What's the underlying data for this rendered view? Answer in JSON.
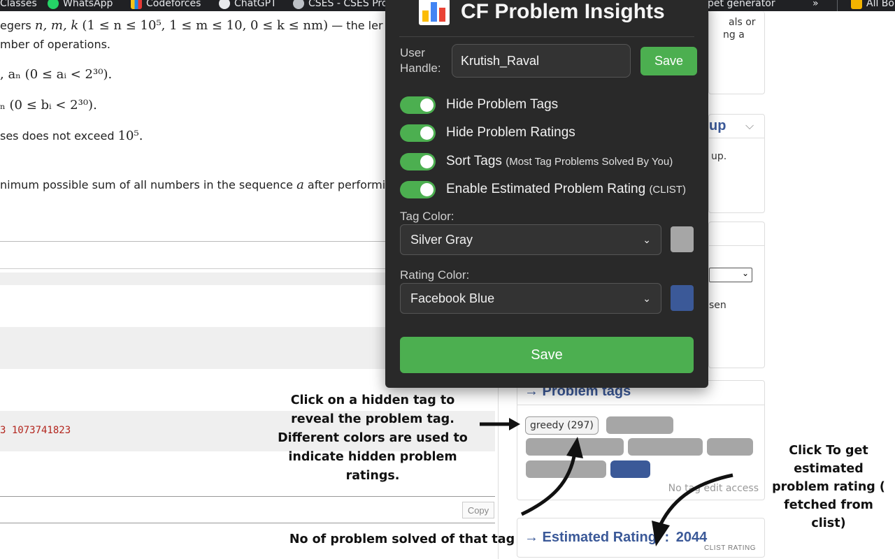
{
  "bookmarks": [
    {
      "label": "Classes",
      "icon": "folder-icon"
    },
    {
      "label": "WhatsApp",
      "icon": "whatsapp-icon"
    },
    {
      "label": "Codeforces",
      "icon": "codeforces-icon"
    },
    {
      "label": "ChatGPT",
      "icon": "chatgpt-icon"
    },
    {
      "label": "CSES - CSES Pro",
      "icon": "globe-icon"
    },
    {
      "label": "pet generator",
      "icon": "bookmark-icon"
    },
    {
      "label": "»",
      "icon": "more-icon"
    },
    {
      "label": "All Bo",
      "icon": "folder-icon"
    }
  ],
  "statement": {
    "line1_prefix": "egers",
    "line1_vars": "n, m, k",
    "line1_constraint": "(1 ≤ n ≤ 10⁵, 1 ≤ m ≤ 10, 0 ≤ k ≤ nm)",
    "line1_suffix": "— the ler",
    "line2": "mber of operations.",
    "line3": ", aₙ (0 ≤ aᵢ < 2³⁰).",
    "line4": "ₙ (0 ≤ bᵢ < 2³⁰).",
    "line5_prefix": "ses does not exceed",
    "line5_math": "10⁵.",
    "line6_prefix": "nimum possible sum of all numbers in the sequence",
    "line6_var": "a",
    "line6_suffix": "after performing"
  },
  "example_output_value": "3 1073741823",
  "copy_label": "Copy",
  "sidebar": {
    "box1_text_a": "als or",
    "box1_text_b": "ng a",
    "box2_title": "up",
    "box2_text": "up.",
    "box3_text": "sen",
    "tags_title": "→ Problem tags",
    "tag_visible": "greedy (297)",
    "no_tag_edit": "No tag edit access",
    "estimated_label": "→ Estimated Rating",
    "estimated_sep": ":",
    "estimated_value": "2044",
    "estimated_sub": "CLIST RATING"
  },
  "popup": {
    "title": "CF Problem Insights",
    "user_handle_label_1": "User",
    "user_handle_label_2": "Handle:",
    "user_handle_value": "Krutish_Raval",
    "save_small": "Save",
    "toggles": [
      {
        "label": "Hide Problem Tags",
        "note": "",
        "on": true
      },
      {
        "label": "Hide Problem Ratings",
        "note": "",
        "on": true
      },
      {
        "label": "Sort Tags",
        "note": "(Most Tag Problems Solved By You)",
        "on": true
      },
      {
        "label": "Enable Estimated Problem Rating",
        "note": "(CLIST)",
        "on": true
      }
    ],
    "tag_color_label": "Tag Color:",
    "tag_color_value": "Silver Gray",
    "tag_color_hex": "#a6a6a6",
    "rating_color_label": "Rating Color:",
    "rating_color_value": "Facebook Blue",
    "rating_color_hex": "#3b5998",
    "save_big": "Save"
  },
  "annotations": {
    "tags_note": "Click on a hidden tag to reveal the problem tag. Different colors are used to indicate hidden problem ratings.",
    "rating_note": "Click To get estimated problem rating ( fetched from clist)",
    "solved_note": "No of problem solved of that tag"
  },
  "colors": {
    "accent_green": "#4caf50",
    "popup_bg": "#292929",
    "cf_blue": "#3b5998",
    "hidden_tag_gray": "#a6a6a6"
  }
}
